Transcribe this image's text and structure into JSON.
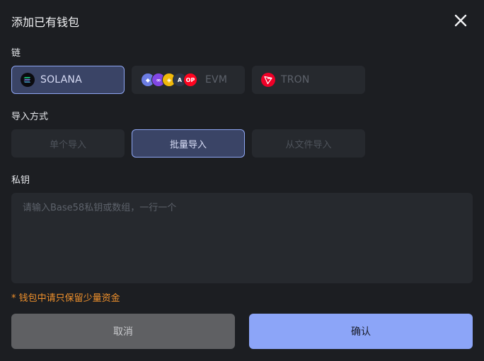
{
  "dialog": {
    "title": "添加已有钱包",
    "close_icon": "close-icon"
  },
  "chain": {
    "label": "链",
    "options": [
      {
        "label": "SOLANA",
        "icon": "solana-icon",
        "selected": true
      },
      {
        "label": "EVM",
        "icon": "evm-chains-icon",
        "selected": false
      },
      {
        "label": "TRON",
        "icon": "tron-icon",
        "selected": false
      }
    ]
  },
  "import_method": {
    "label": "导入方式",
    "options": [
      {
        "label": "单个导入",
        "selected": false
      },
      {
        "label": "批量导入",
        "selected": true
      },
      {
        "label": "从文件导入",
        "selected": false
      }
    ]
  },
  "private_key": {
    "label": "私钥",
    "placeholder": "请输入Base58私钥或数组，一行一个"
  },
  "warning": "* 钱包中请只保留少量资金",
  "buttons": {
    "cancel": "取消",
    "confirm": "确认"
  },
  "colors": {
    "background": "#1c1e22",
    "panel": "#26292e",
    "accent": "#8ca5f8",
    "active_fill": "#3a4466",
    "warning": "#f0912c"
  }
}
